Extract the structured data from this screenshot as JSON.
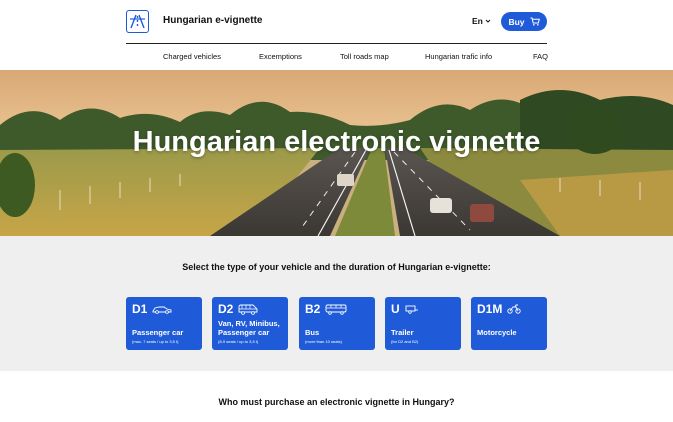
{
  "header": {
    "brand": "Hungarian e-vignette",
    "language": "En",
    "buy_label": "Buy"
  },
  "nav": {
    "items": [
      "Charged vehicles",
      "Excemptions",
      "Toll roads map",
      "Hungarian trafic info",
      "FAQ"
    ]
  },
  "hero": {
    "title": "Hungarian electronic vignette"
  },
  "select": {
    "title": "Select the type of your vehicle and the duration of Hungarian e-vignette:",
    "cards": [
      {
        "code": "D1",
        "name": "Passenger car",
        "sub": "(max. 7 seats / up to 3,5 t)",
        "icon": "car-icon"
      },
      {
        "code": "D2",
        "name": "Van, RV, Minibus, Passenger car",
        "sub": "(8-9 seats / up to 3,5 t)",
        "icon": "van-icon"
      },
      {
        "code": "B2",
        "name": "Bus",
        "sub": "(more than 10 seats)",
        "icon": "bus-icon"
      },
      {
        "code": "U",
        "name": "Trailer",
        "sub": "(for D2 and B2)",
        "icon": "trailer-icon"
      },
      {
        "code": "D1M",
        "name": "Motorcycle",
        "sub": "",
        "icon": "motorcycle-icon"
      }
    ]
  },
  "info": {
    "title": "Who must purchase an electronic vignette in Hungary?"
  },
  "colors": {
    "accent": "#1f5bd8",
    "section_bg": "#efefef"
  }
}
